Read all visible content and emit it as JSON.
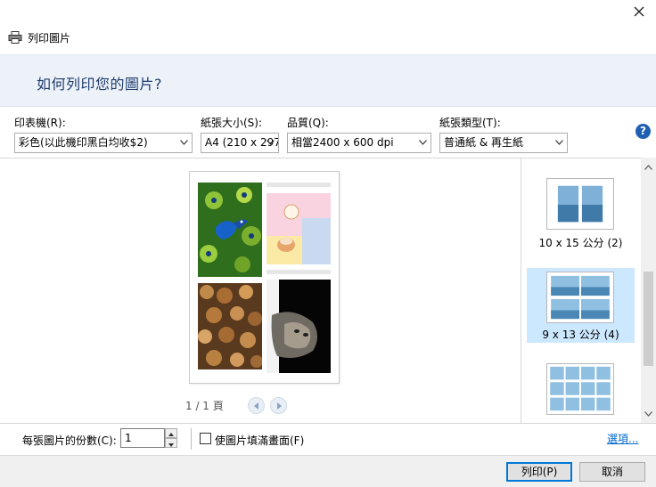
{
  "window": {
    "title": "列印圖片"
  },
  "banner": {
    "heading": "如何列印您的圖片?"
  },
  "options": {
    "printer": {
      "label": "印表機(R):",
      "value": "彩色(以此機印黑白均收$2)"
    },
    "paper_size": {
      "label": "紙張大小(S):",
      "value": "A4 (210 x 297"
    },
    "quality": {
      "label": "品質(Q):",
      "value": "相當2400 x 600 dpi"
    },
    "paper_type": {
      "label": "紙張類型(T):",
      "value": "普通紙 & 再生紙"
    }
  },
  "preview": {
    "page_counter": "1 / 1 頁",
    "photos": [
      "peacock",
      "cartoon",
      "coins",
      "cat"
    ]
  },
  "layouts": [
    {
      "caption": "10 x 15 公分 (2)",
      "selected": false,
      "cols": 2,
      "rows": 1
    },
    {
      "caption": "9 x 13 公分 (4)",
      "selected": true,
      "cols": 2,
      "rows": 2
    },
    {
      "caption": "",
      "selected": false,
      "cols": 4,
      "rows": 3
    }
  ],
  "bottom": {
    "copies_label": "每張圖片的份數(C):",
    "copies_value": "1",
    "fill_label": "使圖片填滿畫面(F)",
    "fill_checked": false,
    "options_link": "選項..."
  },
  "buttons": {
    "print": "列印(P)",
    "cancel": "取消"
  },
  "colors": {
    "accent": "#0078d7",
    "banner_bg": "#edf2f9",
    "selected_bg": "#cce8ff",
    "link": "#0066cc"
  }
}
